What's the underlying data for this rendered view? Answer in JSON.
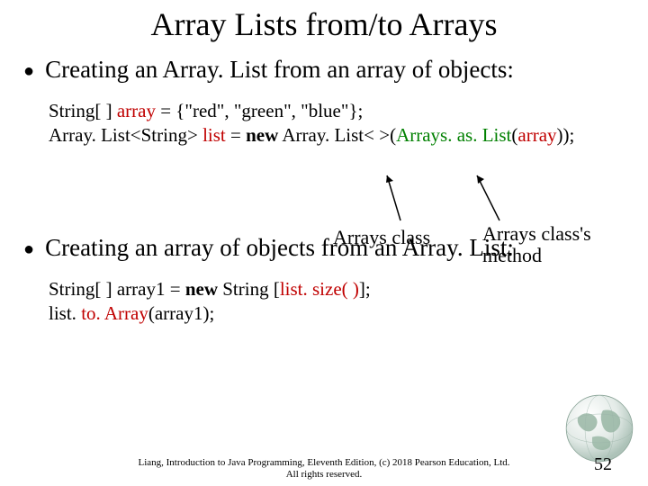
{
  "title": "Array Lists from/to Arrays",
  "bullets": [
    {
      "text": "Creating an Array. List from an array of objects:"
    },
    {
      "text": "Creating an array of objects from an Array. List:"
    }
  ],
  "code1": {
    "line1_a": "String[ ] ",
    "line1_b": "array",
    "line1_c": " = {",
    "line1_d": "\"red\", \"green\", \"blue\"",
    "line1_e": "};",
    "line2_a": "Array. List<String> ",
    "line2_b": "list",
    "line2_c": " = ",
    "line2_d": "new",
    "line2_e": " Array. List< >(",
    "line2_f": "Arrays. as. List",
    "line2_g": "(",
    "line2_h": "array",
    "line2_i": "));"
  },
  "annotations": {
    "arraysClass": "Arrays class",
    "arraysMethod_a": "Arrays class's",
    "arraysMethod_b": "method"
  },
  "code2": {
    "line1_a": "String[ ] array1 = ",
    "line1_b": "new",
    "line1_c": " String [",
    "line1_d": "list. size( )",
    "line1_e": "];",
    "line2_a": "list. ",
    "line2_b": "to. Array",
    "line2_c": "(array1);"
  },
  "footer": {
    "line1": "Liang, Introduction to Java Programming, Eleventh Edition, (c) 2018 Pearson Education, Ltd.",
    "line2": "All rights reserved."
  },
  "page": "52"
}
